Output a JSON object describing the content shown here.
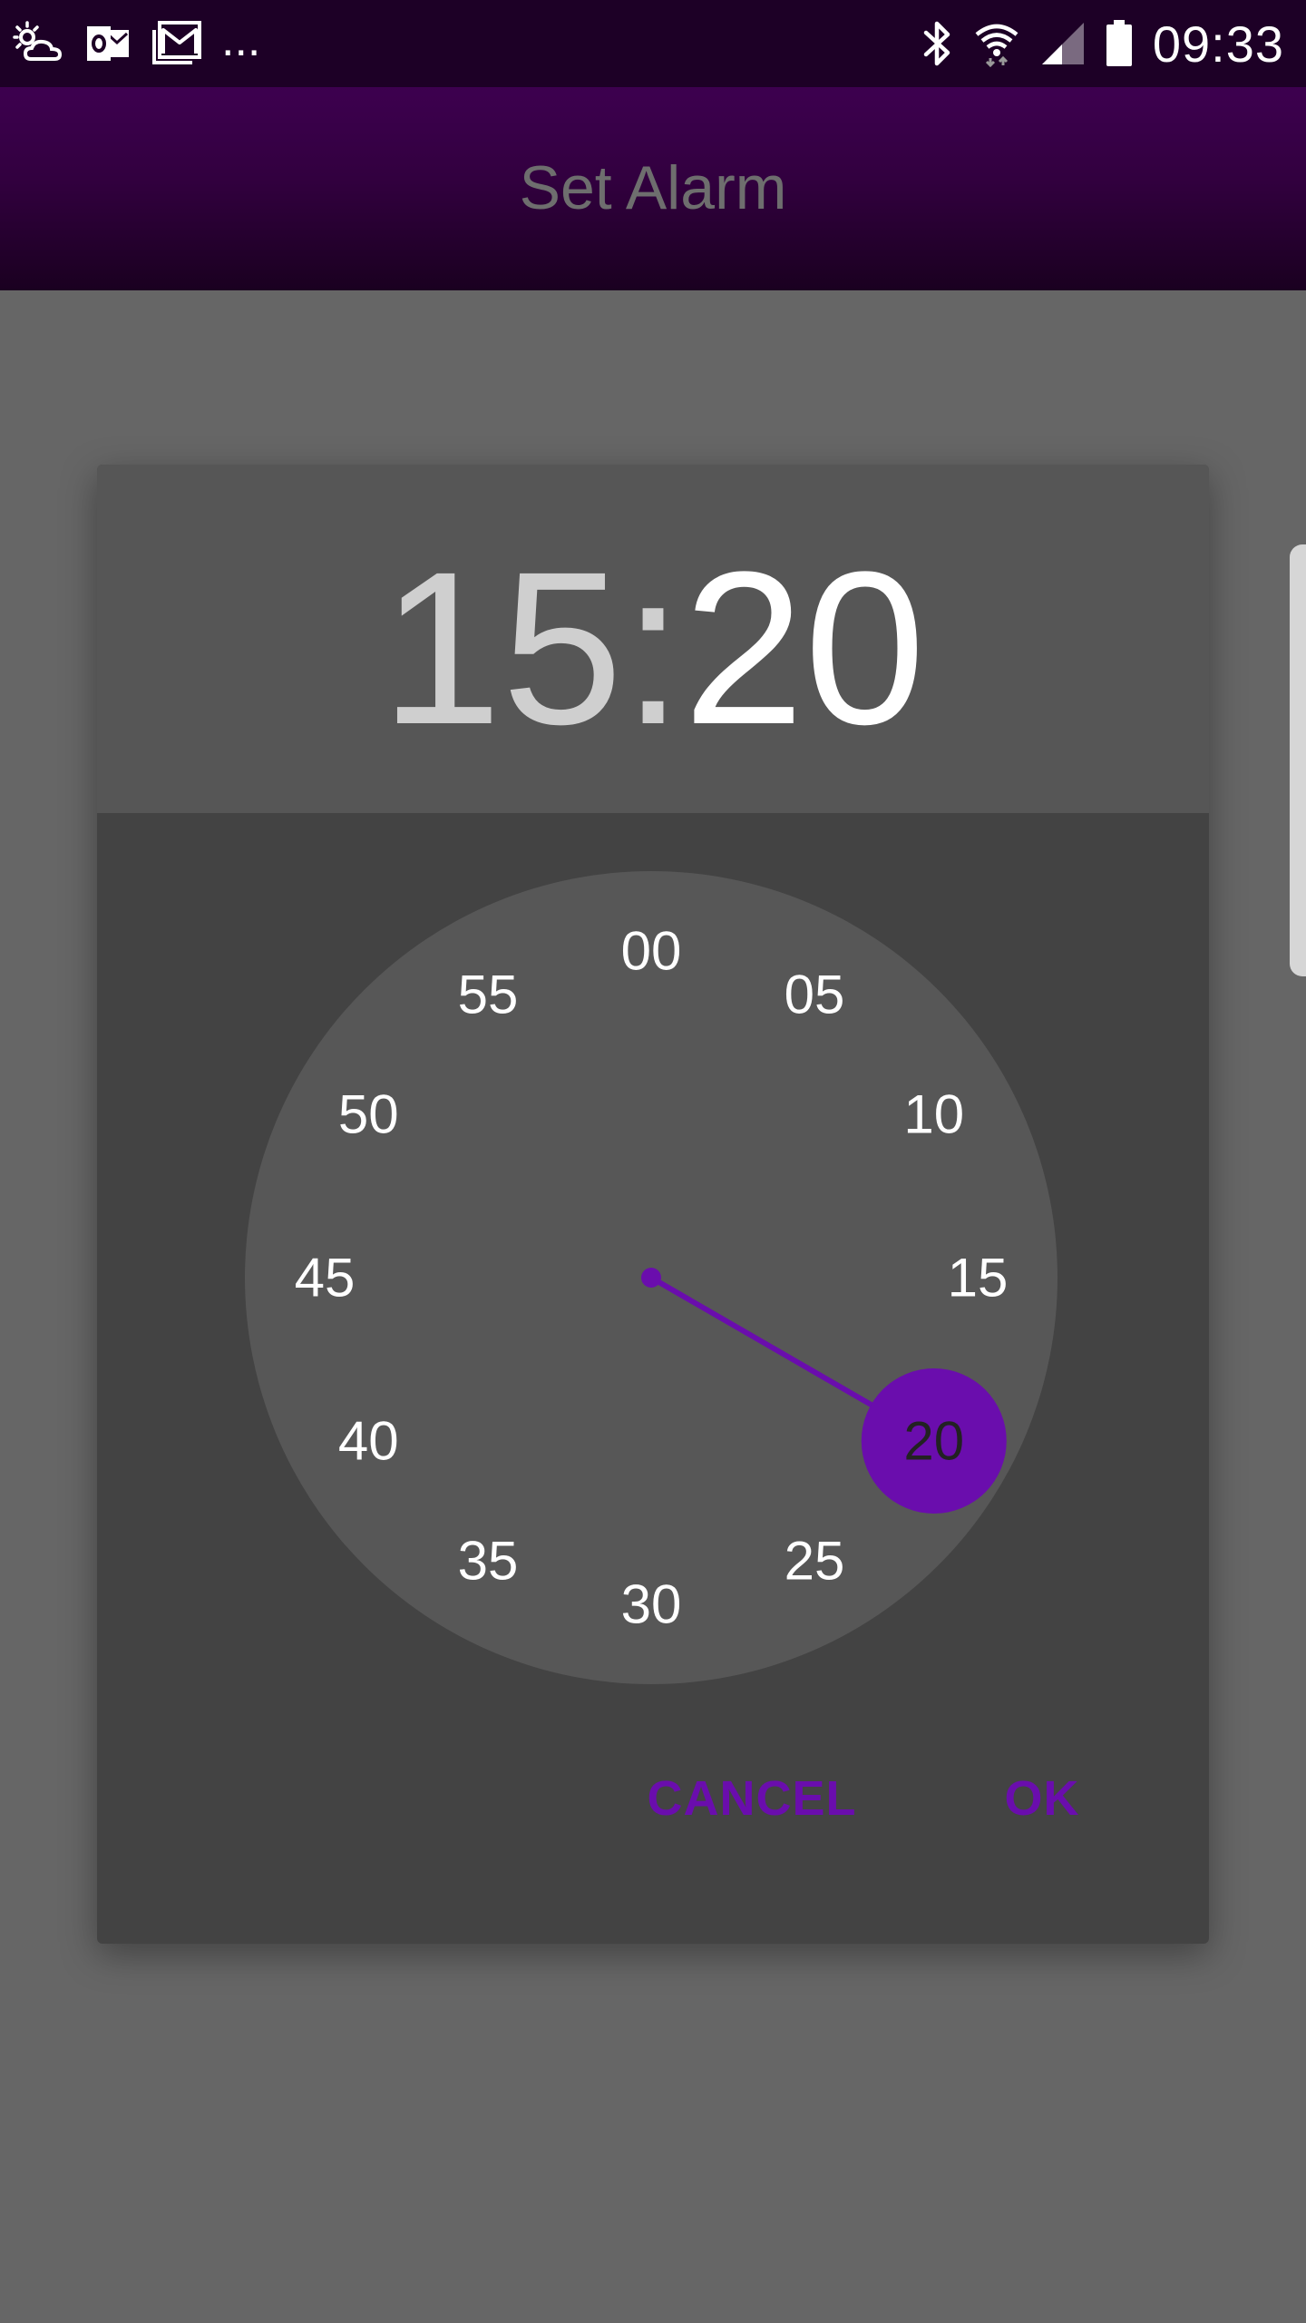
{
  "status_bar": {
    "left_icons": [
      "weather-icon",
      "outlook-icon",
      "gallery-icon"
    ],
    "more_indicator": "...",
    "right_icons": [
      "bluetooth-icon",
      "wifi-icon",
      "signal-icon",
      "battery-icon"
    ],
    "time": "09:33"
  },
  "app_bar": {
    "title": "Set Alarm"
  },
  "time_picker": {
    "hours": "15",
    "separator": ":",
    "minutes": "20",
    "mode": "minutes",
    "selected_minute": 20,
    "dial_labels": [
      "00",
      "05",
      "10",
      "15",
      "20",
      "25",
      "30",
      "35",
      "40",
      "45",
      "50",
      "55"
    ],
    "accent_color": "#6a0dad",
    "dial_color": "#575757",
    "label_color": "#ffffff",
    "selected_label_color": "#222222"
  },
  "actions": {
    "cancel_label": "CANCEL",
    "ok_label": "OK"
  }
}
